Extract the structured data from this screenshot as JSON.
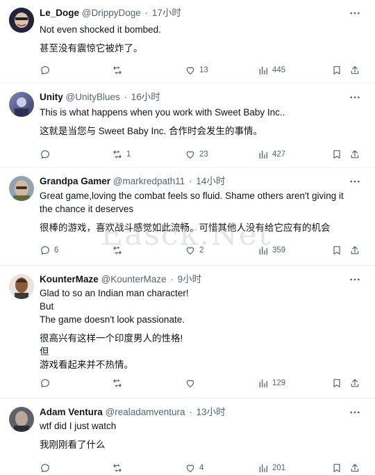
{
  "tweets": [
    {
      "name": "Le_Doge",
      "handle": "@DrippyDoge",
      "time": "17小时",
      "lines_en": [
        "Not even shocked it bombed."
      ],
      "lines_zh": [
        "甚至没有震惊它被炸了。"
      ],
      "reply_count": "",
      "retweet_count": "",
      "like_count": "13",
      "view_count": "445"
    },
    {
      "name": "Unity",
      "handle": "@UnityBlues",
      "time": "16小时",
      "lines_en": [
        "This is what happens when you work with Sweet Baby Inc.."
      ],
      "lines_zh": [
        "这就是当您与 Sweet Baby Inc. 合作时会发生的事情。"
      ],
      "reply_count": "",
      "retweet_count": "1",
      "like_count": "23",
      "view_count": "427"
    },
    {
      "name": "Grandpa Gamer",
      "handle": "@markredpath11",
      "time": "14小时",
      "lines_en": [
        "Great game,loving the combat feels so fluid. Shame others aren't giving it",
        "the chance it deserves"
      ],
      "lines_zh": [
        "很棒的游戏，喜欢战斗感觉如此流畅。可惜其他人没有给它应有的机会"
      ],
      "reply_count": "6",
      "retweet_count": "",
      "like_count": "2",
      "view_count": "359"
    },
    {
      "name": "KounterMaze",
      "handle": "@KounterMaze",
      "time": "9小时",
      "lines_en": [
        "Glad to so an Indian man character!",
        "But",
        "The game doesn't look passionate."
      ],
      "lines_zh": [
        "很高兴有这样一个印度男人的性格!",
        "但",
        "游戏看起来并不热情。"
      ],
      "reply_count": "",
      "retweet_count": "",
      "like_count": "",
      "view_count": "129"
    },
    {
      "name": "Adam Ventura",
      "handle": "@realadamventura",
      "time": "13小时",
      "lines_en": [
        "wtf did I just watch"
      ],
      "lines_zh": [
        "我刚刚看了什么"
      ],
      "reply_count": "",
      "retweet_count": "",
      "like_count": "4",
      "view_count": "201"
    }
  ],
  "watermark": "Easck.Net",
  "colors": {
    "text": "#0f1419",
    "secondary": "#536471",
    "divider": "#eff3f4"
  }
}
